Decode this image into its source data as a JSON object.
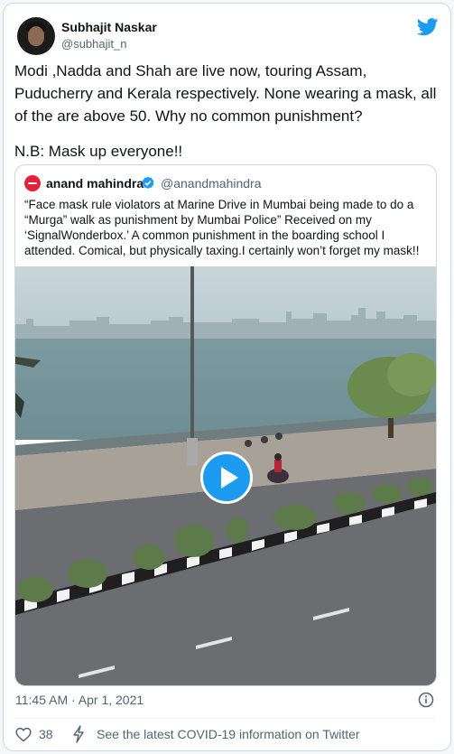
{
  "author": {
    "name": "Subhajit Naskar",
    "handle": "@subhajit_n"
  },
  "tweet": {
    "text": "Modi ,Nadda and Shah are live now, touring Assam, Puducherry and Kerala respectively. None wearing a mask, all of the are above 50. Why no common punishment?",
    "note": "N.B: Mask up everyone!!"
  },
  "quoted": {
    "name": "anand mahindra",
    "handle": "@anandmahindra",
    "text": "“Face mask rule violators at Marine Drive in Mumbai being made to do a “Murga” walk as punishment by Mumbai Police” Received on my ‘SignalWonderbox.’ A common punishment in the boarding school I attended. Comical, but physically taxing.I certainly won’t forget my mask!!"
  },
  "meta": {
    "timestamp": "11:45 AM · Apr 1, 2021"
  },
  "actions": {
    "likes": "38",
    "covid_info": "See the latest COVID-19 information on Twitter"
  },
  "colors": {
    "brand": "#1d9bf0",
    "muted": "#536471",
    "border": "#cfd9de",
    "mahindra_red": "#e2223a"
  },
  "icons": [
    "twitter-bird-icon",
    "verified-badge-icon",
    "play-icon",
    "info-icon",
    "heart-icon",
    "lightning-icon"
  ]
}
